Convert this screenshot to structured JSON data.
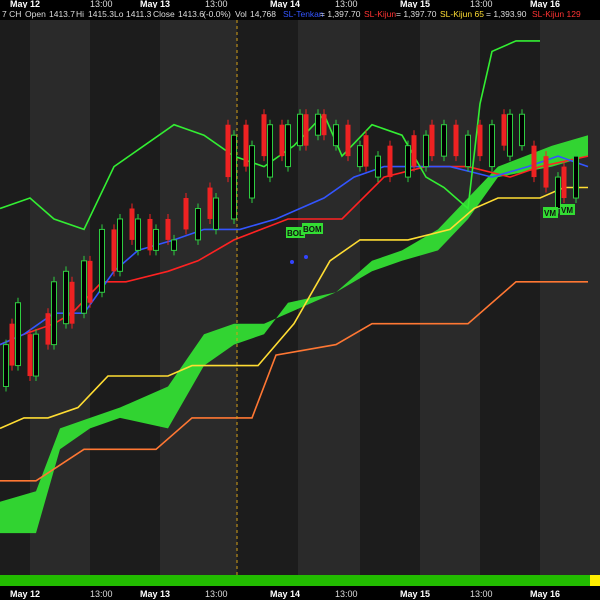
{
  "chart_data": {
    "type": "candlestick",
    "header": {
      "symbol": "7 CH",
      "open_label": "Open",
      "open": "1413.7",
      "high_label": "Hi",
      "high": "1415.3",
      "low_label": "Lo",
      "low": "1411.3",
      "close_label": "Close",
      "close": "1413.6",
      "change": "(-0.0%)",
      "vol_label": "Vol",
      "vol": "14,768"
    },
    "legend": [
      {
        "name": "SL-Tenkan",
        "value": "1,397.70",
        "color": "#3355ff"
      },
      {
        "name": "SL-Kijun",
        "value": "1,397.70",
        "color": "#ff2222"
      },
      {
        "name": "SL-Kijun 65",
        "value": "1,393.90",
        "color": "#ffdd33"
      },
      {
        "name": "SL-Kijun 129",
        "value": "",
        "color": "#ff3333"
      }
    ],
    "x_tick_labels": [
      {
        "label": "May 12",
        "bold": true
      },
      {
        "label": "13:00",
        "bold": false
      },
      {
        "label": "May 13",
        "bold": true
      },
      {
        "label": "13:00",
        "bold": false
      },
      {
        "label": "May 14",
        "bold": true
      },
      {
        "label": "13:00",
        "bold": false
      },
      {
        "label": "May 15",
        "bold": true
      },
      {
        "label": "13:00",
        "bold": false
      },
      {
        "label": "May 16",
        "bold": true
      }
    ],
    "annotations": [
      "BOL",
      "BOM",
      "VM",
      "VM"
    ],
    "colors": {
      "background": "#000000",
      "band_dark": "#1c1c1c",
      "band_light": "#2a2a2a",
      "up_candle": "#2ecc40",
      "down_candle": "#ee2222",
      "cloud": "#33dd33",
      "chikou": "#33ee33",
      "tenkan": "#3355ff",
      "kijun": "#ff2222",
      "kijun65": "#ffdd33",
      "kijun129": "#ff7733",
      "cursor": "#d4a017",
      "status_bar": "#22bb00",
      "status_marker": "#ffee00"
    },
    "series": {
      "kijun129": [
        [
          0,
          1371
        ],
        [
          0.6,
          1371
        ],
        [
          1.4,
          1374
        ],
        [
          2.6,
          1374
        ],
        [
          3.2,
          1377
        ],
        [
          4.2,
          1377
        ],
        [
          4.6,
          1383
        ],
        [
          5.6,
          1384
        ],
        [
          6.2,
          1386
        ],
        [
          7.8,
          1386
        ],
        [
          8.6,
          1390
        ],
        [
          9.8,
          1390
        ]
      ],
      "kijun65": [
        [
          0,
          1376
        ],
        [
          0.4,
          1377
        ],
        [
          0.8,
          1377
        ],
        [
          1.3,
          1378
        ],
        [
          1.8,
          1381
        ],
        [
          2.8,
          1381
        ],
        [
          3.2,
          1382
        ],
        [
          4.3,
          1382
        ],
        [
          4.9,
          1386
        ],
        [
          5.5,
          1392
        ],
        [
          6.0,
          1394
        ],
        [
          6.8,
          1394
        ],
        [
          7.5,
          1395
        ],
        [
          7.9,
          1397
        ],
        [
          8.3,
          1398
        ],
        [
          9.0,
          1398
        ],
        [
          9.4,
          1399
        ],
        [
          9.8,
          1399
        ]
      ],
      "cloud_a": [
        [
          0,
          1366
        ],
        [
          0.6,
          1366
        ],
        [
          1.0,
          1374
        ],
        [
          1.5,
          1376
        ],
        [
          2.0,
          1377
        ],
        [
          2.8,
          1376
        ],
        [
          3.4,
          1382
        ],
        [
          3.9,
          1384
        ],
        [
          4.4,
          1385
        ],
        [
          4.8,
          1388
        ],
        [
          5.6,
          1389
        ],
        [
          6.2,
          1391
        ],
        [
          6.7,
          1392
        ],
        [
          7.3,
          1393
        ],
        [
          7.8,
          1396
        ],
        [
          8.3,
          1400
        ],
        [
          9.2,
          1401
        ],
        [
          9.8,
          1402
        ]
      ],
      "cloud_b": [
        [
          0,
          1369
        ],
        [
          0.6,
          1370
        ],
        [
          1.0,
          1376
        ],
        [
          1.5,
          1377
        ],
        [
          2.0,
          1378
        ],
        [
          2.8,
          1380
        ],
        [
          3.4,
          1385
        ],
        [
          3.9,
          1386
        ],
        [
          4.4,
          1386
        ],
        [
          4.8,
          1387
        ],
        [
          5.6,
          1389
        ],
        [
          6.2,
          1392
        ],
        [
          6.7,
          1393
        ],
        [
          7.3,
          1395
        ],
        [
          7.8,
          1398
        ],
        [
          8.3,
          1401
        ],
        [
          9.2,
          1403
        ],
        [
          9.8,
          1404
        ]
      ],
      "kijun": [
        [
          0,
          1384
        ],
        [
          0.4,
          1385
        ],
        [
          0.9,
          1386
        ],
        [
          1.2,
          1387
        ],
        [
          1.7,
          1390
        ],
        [
          2.1,
          1390
        ],
        [
          2.8,
          1391
        ],
        [
          3.3,
          1392
        ],
        [
          3.9,
          1394
        ],
        [
          4.8,
          1396
        ],
        [
          5.7,
          1396
        ],
        [
          6.4,
          1400
        ],
        [
          7.1,
          1401
        ],
        [
          7.8,
          1401
        ],
        [
          8.5,
          1400
        ],
        [
          9.0,
          1401
        ],
        [
          9.8,
          1402
        ]
      ],
      "tenkan": [
        [
          0,
          1384
        ],
        [
          0.4,
          1385
        ],
        [
          0.9,
          1387
        ],
        [
          1.4,
          1387
        ],
        [
          1.9,
          1391
        ],
        [
          2.3,
          1393
        ],
        [
          2.9,
          1394
        ],
        [
          3.4,
          1395
        ],
        [
          4.0,
          1395
        ],
        [
          4.6,
          1396
        ],
        [
          5.4,
          1398
        ],
        [
          5.9,
          1400
        ],
        [
          6.4,
          1401
        ],
        [
          6.9,
          1401
        ],
        [
          7.5,
          1401
        ],
        [
          8.2,
          1400
        ],
        [
          8.8,
          1401
        ],
        [
          9.3,
          1402
        ],
        [
          9.8,
          1401
        ]
      ],
      "chikou": [
        [
          0,
          1397
        ],
        [
          0.5,
          1398
        ],
        [
          0.9,
          1396
        ],
        [
          1.4,
          1395
        ],
        [
          1.9,
          1401
        ],
        [
          2.4,
          1403
        ],
        [
          2.9,
          1405
        ],
        [
          3.4,
          1404
        ],
        [
          3.9,
          1402
        ],
        [
          4.4,
          1401
        ],
        [
          4.9,
          1403
        ],
        [
          5.4,
          1406
        ],
        [
          5.7,
          1402
        ],
        [
          6.2,
          1405
        ],
        [
          6.7,
          1404
        ],
        [
          7.1,
          1400
        ],
        [
          7.4,
          1399
        ],
        [
          7.8,
          1397
        ],
        [
          8.0,
          1407
        ],
        [
          8.2,
          1412
        ],
        [
          8.6,
          1413
        ],
        [
          9.0,
          1413
        ]
      ],
      "candles_up": [
        [
          0.1,
          1380,
          1384
        ],
        [
          0.3,
          1382,
          1388
        ],
        [
          0.6,
          1381,
          1385
        ],
        [
          0.9,
          1384,
          1390
        ],
        [
          1.1,
          1386,
          1391
        ],
        [
          1.4,
          1387,
          1392
        ],
        [
          1.7,
          1389,
          1395
        ],
        [
          2.0,
          1391,
          1396
        ],
        [
          2.3,
          1393,
          1396
        ],
        [
          2.6,
          1393,
          1395
        ],
        [
          2.9,
          1393,
          1394
        ],
        [
          3.3,
          1394,
          1397
        ],
        [
          3.6,
          1395,
          1398
        ],
        [
          3.9,
          1396,
          1404
        ],
        [
          4.2,
          1398,
          1403
        ],
        [
          4.5,
          1400,
          1405
        ],
        [
          4.8,
          1401,
          1405
        ],
        [
          5.0,
          1403,
          1406
        ],
        [
          5.3,
          1404,
          1406
        ],
        [
          5.6,
          1403,
          1405
        ],
        [
          6.0,
          1401,
          1403
        ],
        [
          6.3,
          1400,
          1402
        ],
        [
          6.8,
          1400,
          1403
        ],
        [
          7.1,
          1401,
          1404
        ],
        [
          7.4,
          1402,
          1405
        ],
        [
          7.8,
          1401,
          1404
        ],
        [
          8.2,
          1401,
          1405
        ],
        [
          8.5,
          1402,
          1406
        ],
        [
          8.7,
          1403,
          1406
        ],
        [
          9.3,
          1397,
          1400
        ],
        [
          9.6,
          1398,
          1402
        ]
      ],
      "candles_down": [
        [
          0.2,
          1386,
          1382
        ],
        [
          0.5,
          1385,
          1381
        ],
        [
          0.8,
          1387,
          1384
        ],
        [
          1.2,
          1390,
          1386
        ],
        [
          1.5,
          1392,
          1388
        ],
        [
          1.9,
          1395,
          1391
        ],
        [
          2.2,
          1397,
          1394
        ],
        [
          2.5,
          1396,
          1393
        ],
        [
          2.8,
          1396,
          1394
        ],
        [
          3.1,
          1398,
          1395
        ],
        [
          3.5,
          1399,
          1396
        ],
        [
          3.8,
          1405,
          1400
        ],
        [
          4.1,
          1405,
          1401
        ],
        [
          4.4,
          1406,
          1402
        ],
        [
          4.7,
          1405,
          1402
        ],
        [
          5.1,
          1406,
          1403
        ],
        [
          5.4,
          1406,
          1404
        ],
        [
          5.8,
          1405,
          1402
        ],
        [
          6.1,
          1404,
          1401
        ],
        [
          6.5,
          1403,
          1400
        ],
        [
          6.9,
          1404,
          1401
        ],
        [
          7.2,
          1405,
          1402
        ],
        [
          7.6,
          1405,
          1402
        ],
        [
          8.0,
          1405,
          1402
        ],
        [
          8.4,
          1406,
          1403
        ],
        [
          8.9,
          1403,
          1400
        ],
        [
          9.1,
          1402,
          1399
        ],
        [
          9.4,
          1401,
          1398
        ]
      ]
    }
  }
}
